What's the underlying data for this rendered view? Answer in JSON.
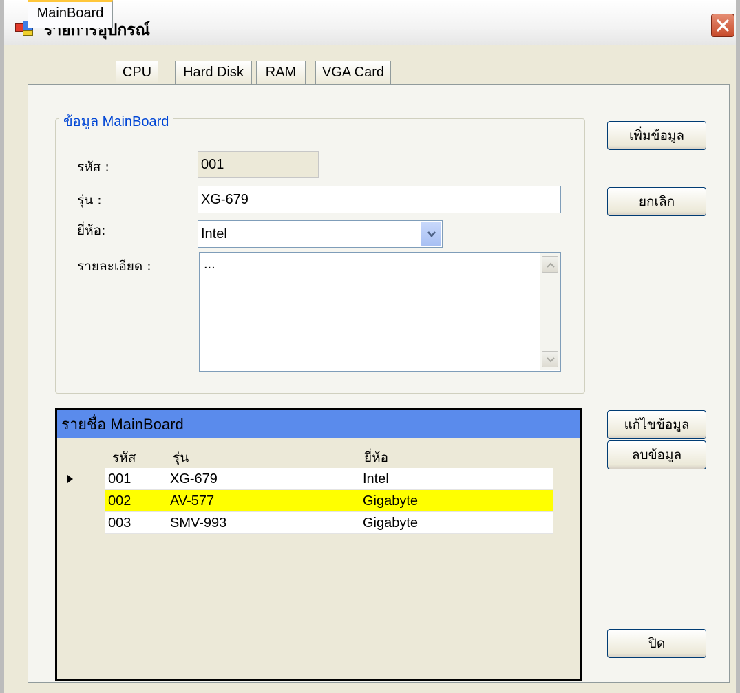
{
  "window": {
    "title": "รายการอุปกรณ์",
    "icon": "app-window-icon"
  },
  "tabs": [
    {
      "label": "MainBoard",
      "active": true
    },
    {
      "label": "CPU",
      "active": false
    },
    {
      "label": "Hard Disk",
      "active": false
    },
    {
      "label": "RAM",
      "active": false
    },
    {
      "label": "VGA Card",
      "active": false
    }
  ],
  "group": {
    "title": "ข้อมูล MainBoard"
  },
  "form": {
    "code_label": "รหัส :",
    "code_value": "001",
    "model_label": "รุ่น :",
    "model_value": "XG-679",
    "brand_label": "ยี่ห้อ:",
    "brand_value": "Intel",
    "detail_label": "รายละเอียด :",
    "detail_value": "..."
  },
  "buttons": {
    "add": "เพิ่มข้อมูล",
    "cancel": "ยกเลิก",
    "edit": "แก้ไขข้อมูล",
    "delete": "ลบข้อมูล",
    "close": "ปิด"
  },
  "grid": {
    "caption": "รายชื่อ MainBoard",
    "columns": [
      "รหัส",
      "รุ่น",
      "ยี่ห้อ"
    ],
    "rows": [
      {
        "code": "001",
        "model": "XG-679",
        "brand": "Intel",
        "selected": false,
        "current": true
      },
      {
        "code": "002",
        "model": "AV-577",
        "brand": "Gigabyte",
        "selected": true,
        "current": false
      },
      {
        "code": "003",
        "model": "SMV-993",
        "brand": "Gigabyte",
        "selected": false,
        "current": false
      }
    ]
  },
  "colors": {
    "grid_caption_bg": "#5a8bec",
    "selected_row_bg": "#ffff00",
    "group_title": "#0046d5",
    "active_tab_accent": "#ffc73c"
  }
}
